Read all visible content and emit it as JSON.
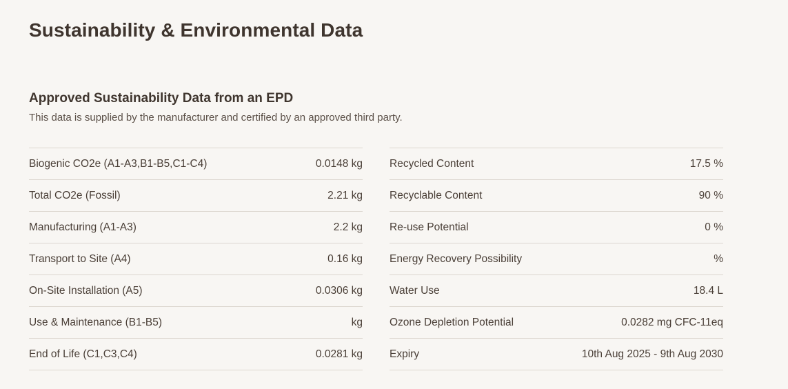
{
  "page": {
    "title": "Sustainability & Environmental Data"
  },
  "epd": {
    "title": "Approved Sustainability Data from an EPD",
    "description": "This data is supplied by the manufacturer and certified by an approved third party."
  },
  "left_table": [
    {
      "label": "Biogenic CO2e (A1-A3,B1-B5,C1-C4)",
      "value": "0.0148 kg"
    },
    {
      "label": "Total CO2e (Fossil)",
      "value": "2.21 kg"
    },
    {
      "label": "Manufacturing (A1-A3)",
      "value": "2.2 kg"
    },
    {
      "label": "Transport to Site (A4)",
      "value": "0.16 kg"
    },
    {
      "label": "On-Site Installation (A5)",
      "value": "0.0306 kg"
    },
    {
      "label": "Use & Maintenance (B1-B5)",
      "value": "kg"
    },
    {
      "label": "End of Life (C1,C3,C4)",
      "value": "0.0281 kg"
    }
  ],
  "right_table": [
    {
      "label": "Recycled Content",
      "value": "17.5 %"
    },
    {
      "label": "Recyclable Content",
      "value": "90 %"
    },
    {
      "label": "Re-use Potential",
      "value": "0 %"
    },
    {
      "label": "Energy Recovery Possibility",
      "value": "%"
    },
    {
      "label": "Water Use",
      "value": "18.4 L"
    },
    {
      "label": "Ozone Depletion Potential",
      "value": "0.0282 mg CFC-11eq"
    },
    {
      "label": "Expiry",
      "value": "10th Aug 2025 - 9th Aug 2030"
    }
  ]
}
